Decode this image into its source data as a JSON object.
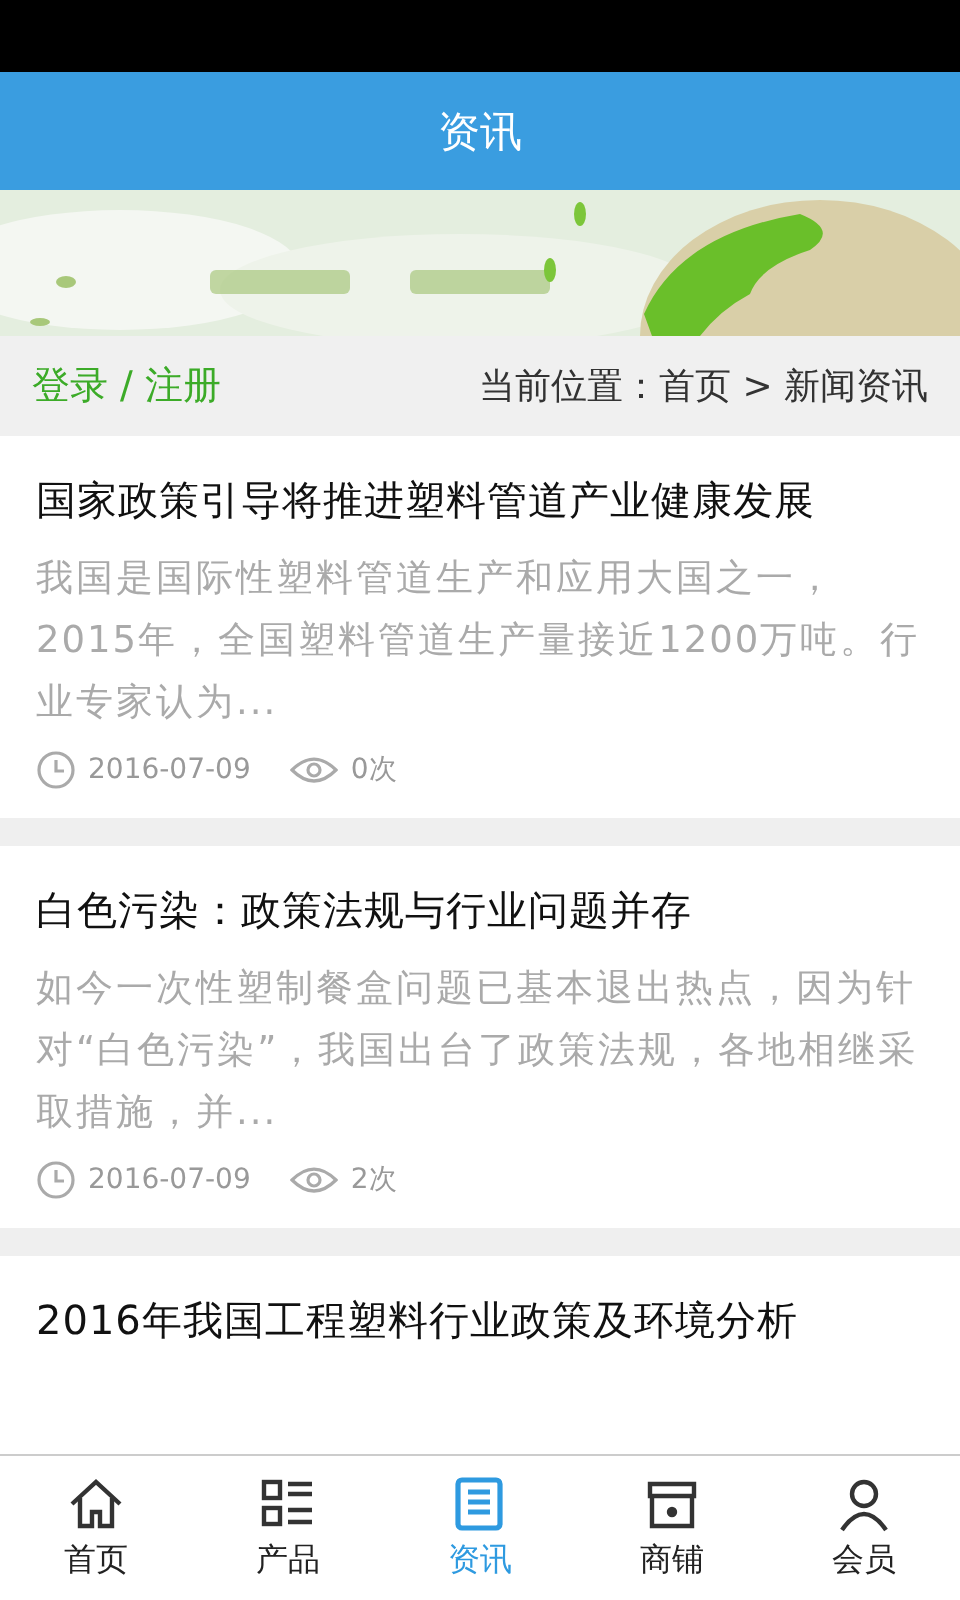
{
  "header": {
    "title": "资讯"
  },
  "breadcrumb": {
    "login": "登录 / 注册",
    "location": "当前位置：首页 > 新闻资讯"
  },
  "articles": [
    {
      "title": "国家政策引导将推进塑料管道产业健康发展",
      "summary": "我国是国际性塑料管道生产和应用大国之一，2015年，全国塑料管道生产量接近1200万吨。行业专家认为...",
      "date": "2016-07-09",
      "views": "0次"
    },
    {
      "title": "白色污染：政策法规与行业问题并存",
      "summary": "如今一次性塑制餐盒问题已基本退出热点，因为针对“白色污染”，我国出台了政策法规，各地相继采取措施，并...",
      "date": "2016-07-09",
      "views": "2次"
    },
    {
      "title": "2016年我国工程塑料行业政策及环境分析"
    }
  ],
  "tabs": [
    {
      "label": "首页",
      "kind": "home",
      "selected": false
    },
    {
      "label": "产品",
      "kind": "list",
      "selected": false
    },
    {
      "label": "资讯",
      "kind": "news",
      "selected": true
    },
    {
      "label": "商铺",
      "kind": "shop",
      "selected": false
    },
    {
      "label": "会员",
      "kind": "user",
      "selected": false
    }
  ]
}
